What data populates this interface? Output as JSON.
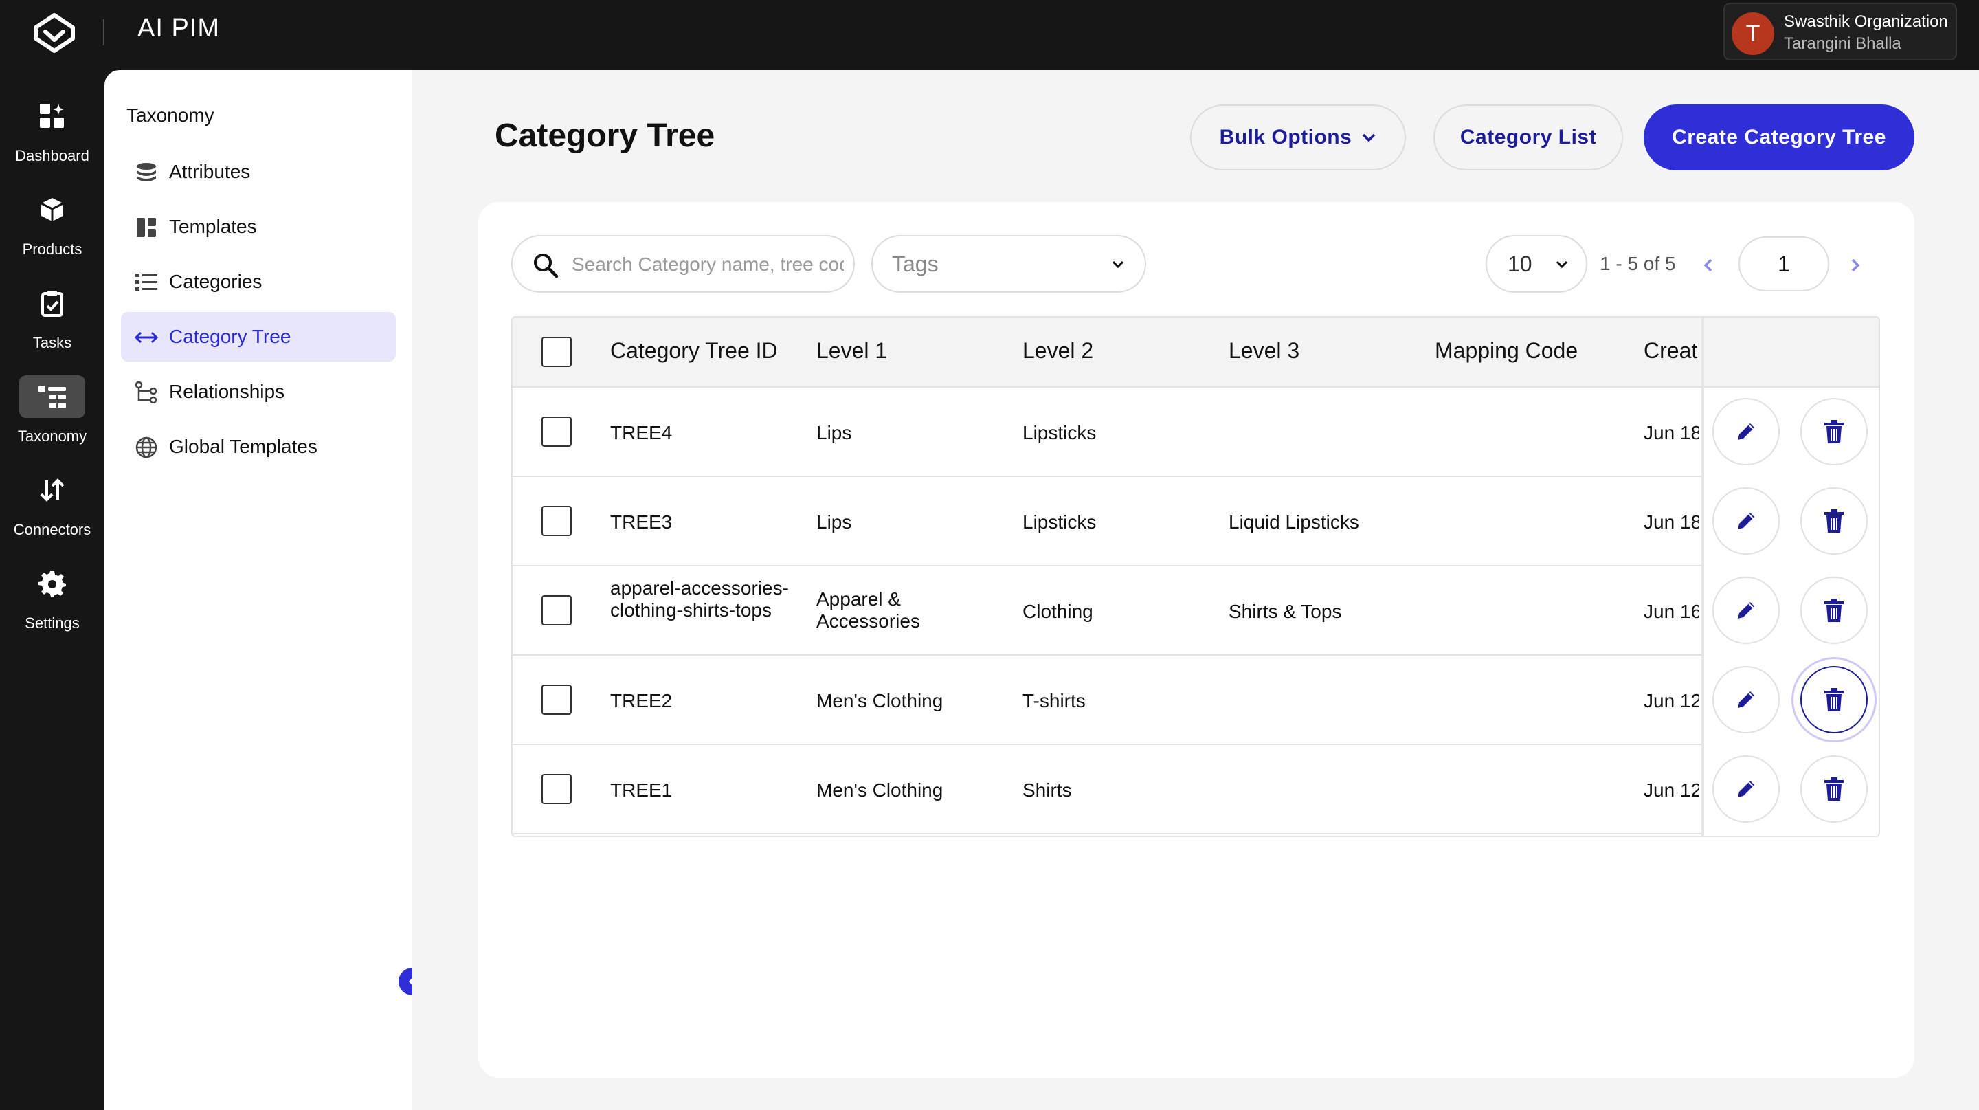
{
  "app": {
    "name": "AI PIM"
  },
  "org": {
    "initial": "T",
    "name": "Swasthik Organization",
    "user": "Tarangini Bhalla"
  },
  "rail": [
    {
      "label": "Dashboard",
      "icon": "dashboard-icon"
    },
    {
      "label": "Products",
      "icon": "box-icon"
    },
    {
      "label": "Tasks",
      "icon": "clipboard-icon"
    },
    {
      "label": "Taxonomy",
      "icon": "taxonomy-icon",
      "active": true
    },
    {
      "label": "Connectors",
      "icon": "arrows-icon"
    },
    {
      "label": "Settings",
      "icon": "gear-icon"
    }
  ],
  "subnav": {
    "title": "Taxonomy",
    "items": [
      {
        "label": "Attributes",
        "icon": "database-icon"
      },
      {
        "label": "Templates",
        "icon": "layout-icon"
      },
      {
        "label": "Categories",
        "icon": "list-icon"
      },
      {
        "label": "Category Tree",
        "icon": "horizontal-arrows-icon",
        "active": true
      },
      {
        "label": "Relationships",
        "icon": "tree-icon"
      },
      {
        "label": "Global Templates",
        "icon": "globe-icon"
      }
    ]
  },
  "page": {
    "title": "Category Tree",
    "bulk_options": "Bulk Options",
    "category_list": "Category List",
    "create": "Create Category Tree"
  },
  "filters": {
    "search_placeholder": "Search Category name, tree code",
    "tags_label": "Tags",
    "per_page": "10",
    "range": "1 - 5 of 5",
    "current_page": "1"
  },
  "table": {
    "columns": [
      "Category Tree ID",
      "Level 1",
      "Level 2",
      "Level 3",
      "Mapping Code",
      "Creat"
    ],
    "rows": [
      {
        "id": "TREE4",
        "level1": "Lips",
        "level2": "Lipsticks",
        "level3": "",
        "mapping": "",
        "created": "Jun 18"
      },
      {
        "id": "TREE3",
        "level1": "Lips",
        "level2": "Lipsticks",
        "level3": "Liquid Lipsticks",
        "mapping": "",
        "created": "Jun 18"
      },
      {
        "id": "apparel-accessories-clothing-shirts-tops",
        "level1": "Apparel & Accessories",
        "level2": "Clothing",
        "level3": "Shirts & Tops",
        "mapping": "",
        "created": "Jun 16"
      },
      {
        "id": "TREE2",
        "level1": "Men's Clothing",
        "level2": "T-shirts",
        "level3": "",
        "mapping": "",
        "created": "Jun 12"
      },
      {
        "id": "TREE1",
        "level1": "Men's Clothing",
        "level2": "Shirts",
        "level3": "",
        "mapping": "",
        "created": "Jun 12"
      }
    ]
  },
  "colors": {
    "accent": "#2f2fd8",
    "navy": "#1d1d9a",
    "avatar": "#b6371e",
    "dark": "#161616"
  }
}
